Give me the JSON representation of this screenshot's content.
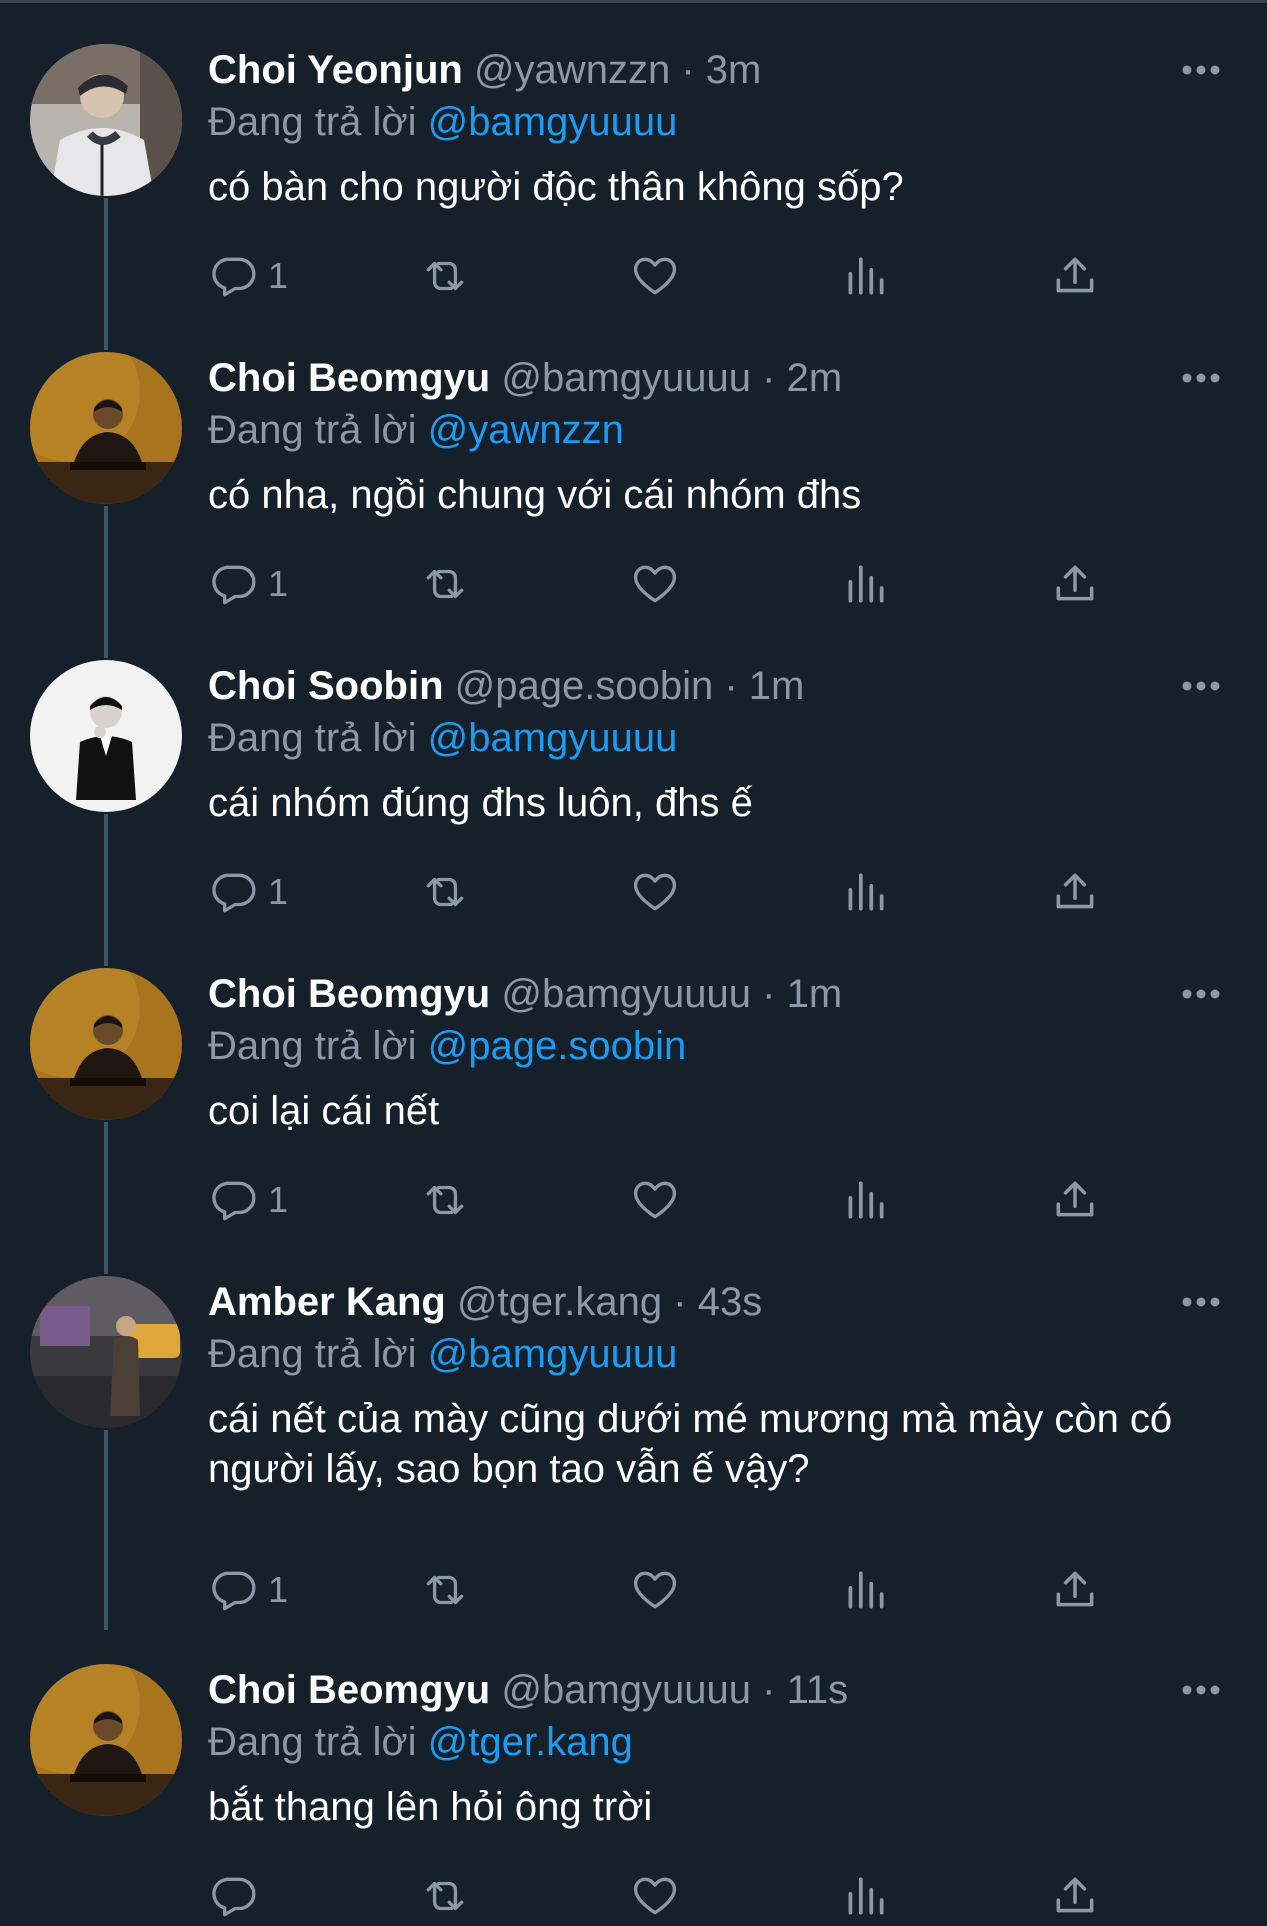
{
  "reply_prefix": "Đang trả lời",
  "colors": {
    "background": "#15202b",
    "secondary_text": "#8b98a5",
    "link": "#1d9bf0"
  },
  "tweets": [
    {
      "name": "Choi Yeonjun",
      "handle": "@yawnzzn",
      "dot": "·",
      "time": "3m",
      "replying_to": "@bamgyuuuu",
      "text": "có bàn cho người độc thân không sốp?",
      "reply_count": "1",
      "avatar": "avatar-jacket-photo"
    },
    {
      "name": "Choi Beomgyu",
      "handle": "@bamgyuuuu",
      "dot": "·",
      "time": "2m",
      "replying_to": "@yawnzzn",
      "text": "có nha, ngồi chung với cái nhóm đhs",
      "reply_count": "1",
      "avatar": "avatar-candlelight-photo"
    },
    {
      "name": "Choi Soobin",
      "handle": "@page.soobin",
      "dot": "·",
      "time": "1m",
      "replying_to": "@bamgyuuuu",
      "text": "cái nhóm đúng đhs luôn, đhs ế",
      "reply_count": "1",
      "avatar": "avatar-suit-photo"
    },
    {
      "name": "Choi Beomgyu",
      "handle": "@bamgyuuuu",
      "dot": "·",
      "time": "1m",
      "replying_to": "@page.soobin",
      "text": "coi lại cái nết",
      "reply_count": "1",
      "avatar": "avatar-candlelight-photo"
    },
    {
      "name": "Amber Kang",
      "handle": "@tger.kang",
      "dot": "·",
      "time": "43s",
      "replying_to": "@bamgyuuuu",
      "text": "cái nết của mày cũng dưới mé mương mà mày còn có người lấy, sao bọn tao vẫn ế vậy?",
      "reply_count": "1",
      "avatar": "avatar-street-photo"
    },
    {
      "name": "Choi Beomgyu",
      "handle": "@bamgyuuuu",
      "dot": "·",
      "time": "11s",
      "replying_to": "@tger.kang",
      "text": "bắt thang lên hỏi ông trời",
      "reply_count": "",
      "avatar": "avatar-candlelight-photo"
    }
  ]
}
